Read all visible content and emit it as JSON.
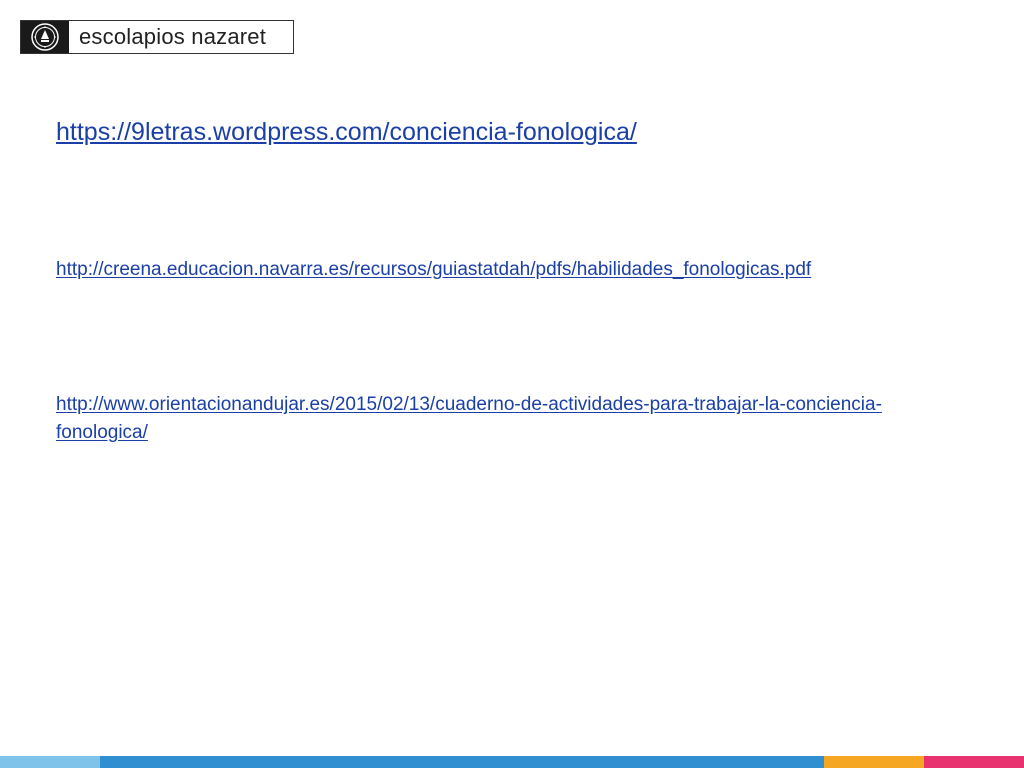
{
  "header": {
    "logo_text": "escolapios nazaret",
    "logo_icon": "seal-icon"
  },
  "links": [
    {
      "text": "https://9letras.wordpress.com/conciencia-fonologica/"
    },
    {
      "text": "http://creena.educacion.navarra.es/recursos/guiastatdah/pdfs/habilidades_fonologicas.pdf"
    },
    {
      "text": "http://www.orientacionandujar.es/2015/02/13/cuaderno-de-actividades-para-trabajar-la-conciencia-fonologica/"
    }
  ],
  "colors": {
    "link": "#1a3fa8",
    "bar_light_blue": "#7fc3ea",
    "bar_blue": "#2f8fd0",
    "bar_orange": "#f5a623",
    "bar_pink": "#e8316f"
  }
}
